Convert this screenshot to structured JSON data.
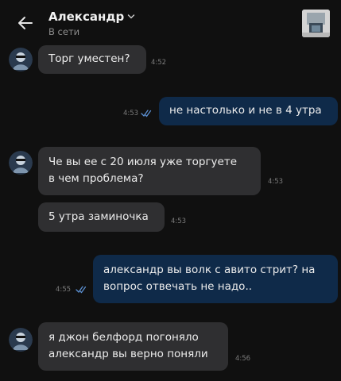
{
  "header": {
    "contact_name": "Александр",
    "status": "В сети"
  },
  "messages": [
    {
      "direction": "in",
      "text": "Торг уместен?",
      "time": "4:52"
    },
    {
      "direction": "out",
      "text": "не настолько и не в 4 утра",
      "time": "4:53",
      "read": true
    },
    {
      "direction": "in",
      "lines": [
        "Че вы ее с 20 июля уже торгуете",
        "в чем проблема?"
      ],
      "time": "4:53"
    },
    {
      "direction": "in",
      "text": "5 утра заминочка",
      "time": "4:53"
    },
    {
      "direction": "out",
      "lines": [
        "александр вы волк с авито стрит? на",
        "вопрос отвечать не надо.."
      ],
      "time": "4:55",
      "read": true
    },
    {
      "direction": "in",
      "lines": [
        "я джон белфорд погоняло",
        "александр вы верно поняли"
      ],
      "time": "4:56"
    }
  ],
  "colors": {
    "background": "#101010",
    "incoming_bubble": "#2f2f31",
    "outgoing_bubble": "#0f2a49",
    "read_check": "#5b8fd0"
  },
  "icons": {
    "back": "arrow-left-icon",
    "expand": "chevron-down-icon",
    "read": "double-check-icon"
  }
}
